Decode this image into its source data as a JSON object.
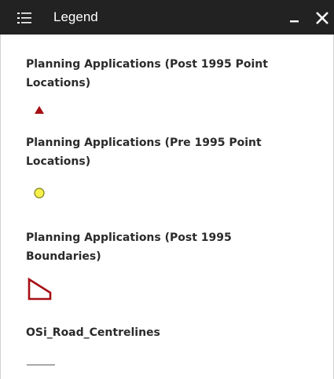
{
  "window": {
    "title": "Legend",
    "icon": "list-icon",
    "minimize_icon": "minimize-icon",
    "close_icon": "close-icon"
  },
  "legend": {
    "layers": [
      {
        "label": "Planning Applications (Post 1995 Point Locations)",
        "symbol": "triangle-marker",
        "symbol_color": "#a50f15"
      },
      {
        "label": "Planning Applications (Pre 1995 Point Locations)",
        "symbol": "circle-marker",
        "symbol_color": "#f5f04a"
      },
      {
        "label": "Planning Applications (Post 1995 Boundaries)",
        "symbol": "polygon-outline",
        "symbol_color": "#a50f15"
      },
      {
        "label": "OSi_Road_Centrelines",
        "symbol": "line-symbol",
        "symbol_color": "#8c8c8c"
      }
    ]
  },
  "colors": {
    "titlebar_bg": "#222222",
    "titlebar_text": "#ffffff",
    "label_text": "#2b2b2b",
    "panel_bg": "#ffffff"
  }
}
